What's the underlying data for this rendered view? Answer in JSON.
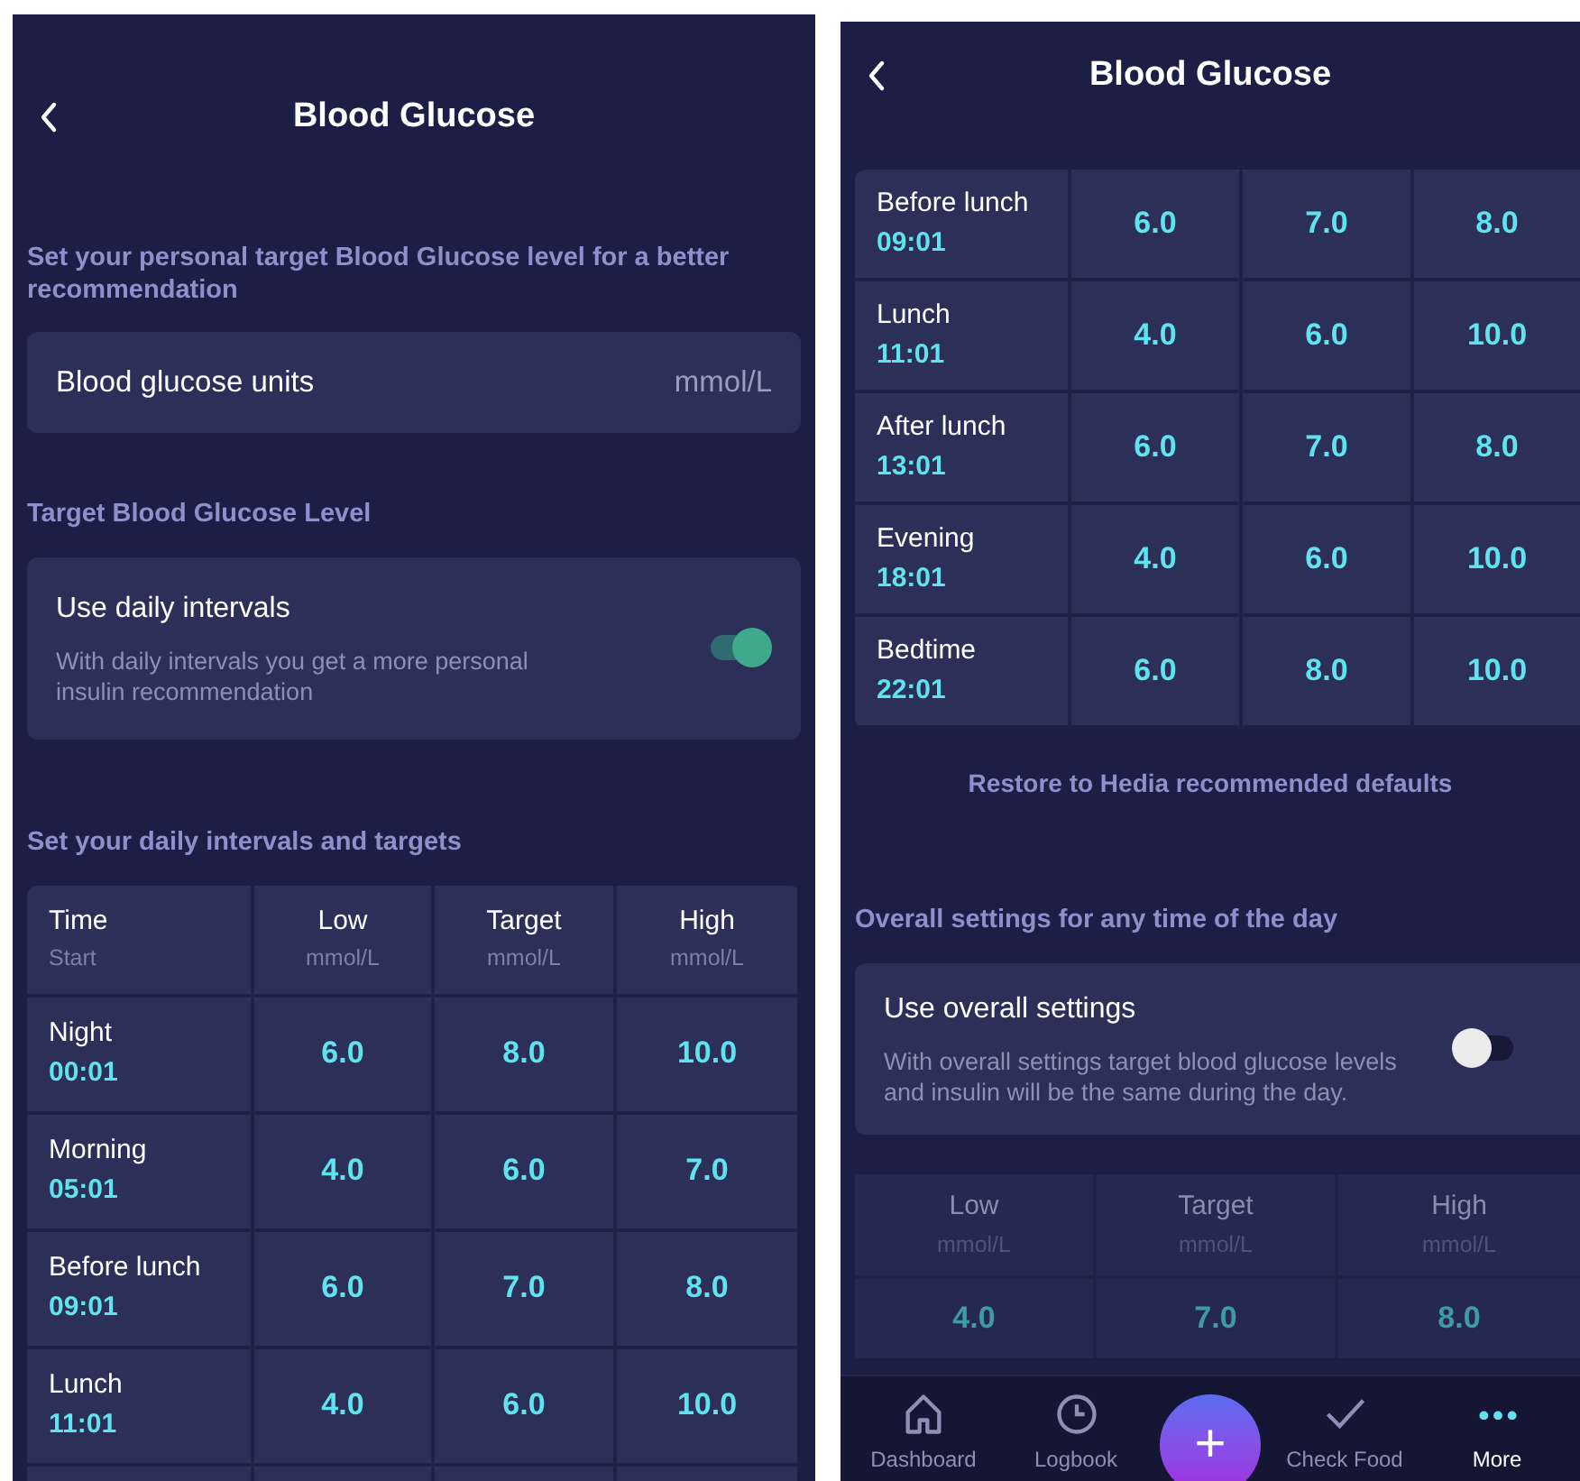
{
  "screens": [
    {
      "title": "Blood Glucose",
      "intro": "Set your personal target Blood Glucose level for a better recommendation",
      "units": {
        "label": "Blood glucose units",
        "value": "mmol/L"
      },
      "target_heading": "Target Blood Glucose Level",
      "toggle": {
        "label": "Use daily intervals",
        "description": "With daily intervals you get a more personal insulin recommendation",
        "on": true
      },
      "intervals_heading": "Set your daily intervals and targets",
      "table": {
        "columns": [
          {
            "label": "Time",
            "sub": "Start"
          },
          {
            "label": "Low",
            "sub": "mmol/L"
          },
          {
            "label": "Target",
            "sub": "mmol/L"
          },
          {
            "label": "High",
            "sub": "mmol/L"
          }
        ],
        "rows": [
          {
            "name": "Night",
            "time": "00:01",
            "low": "6.0",
            "target": "8.0",
            "high": "10.0"
          },
          {
            "name": "Morning",
            "time": "05:01",
            "low": "4.0",
            "target": "6.0",
            "high": "7.0"
          },
          {
            "name": "Before lunch",
            "time": "09:01",
            "low": "6.0",
            "target": "7.0",
            "high": "8.0"
          },
          {
            "name": "Lunch",
            "time": "11:01",
            "low": "4.0",
            "target": "6.0",
            "high": "10.0"
          }
        ]
      }
    },
    {
      "title": "Blood Glucose",
      "table": {
        "rows": [
          {
            "name": "Before lunch",
            "time": "09:01",
            "low": "6.0",
            "target": "7.0",
            "high": "8.0"
          },
          {
            "name": "Lunch",
            "time": "11:01",
            "low": "4.0",
            "target": "6.0",
            "high": "10.0"
          },
          {
            "name": "After lunch",
            "time": "13:01",
            "low": "6.0",
            "target": "7.0",
            "high": "8.0"
          },
          {
            "name": "Evening",
            "time": "18:01",
            "low": "4.0",
            "target": "6.0",
            "high": "10.0"
          },
          {
            "name": "Bedtime",
            "time": "22:01",
            "low": "6.0",
            "target": "8.0",
            "high": "10.0"
          }
        ]
      },
      "restore_link": "Restore to Hedia recommended defaults",
      "overall_heading": "Overall settings for any time of the day",
      "toggle": {
        "label": "Use overall settings",
        "description": "With overall settings target blood glucose levels and insulin will be the same during the day.",
        "on": false
      },
      "overall": {
        "disabled": true,
        "columns": [
          {
            "label": "Low",
            "sub": "mmol/L",
            "value": "4.0"
          },
          {
            "label": "Target",
            "sub": "mmol/L",
            "value": "7.0"
          },
          {
            "label": "High",
            "sub": "mmol/L",
            "value": "8.0"
          }
        ]
      },
      "nav": {
        "items": [
          {
            "kind": "home",
            "label": "Dashboard",
            "selected": false
          },
          {
            "kind": "clock",
            "label": "Logbook",
            "selected": false
          },
          {
            "kind": "fab",
            "label": "+",
            "selected": false
          },
          {
            "kind": "check",
            "label": "Check Food",
            "selected": false
          },
          {
            "kind": "dots",
            "label": "More",
            "selected": true
          }
        ]
      }
    }
  ]
}
